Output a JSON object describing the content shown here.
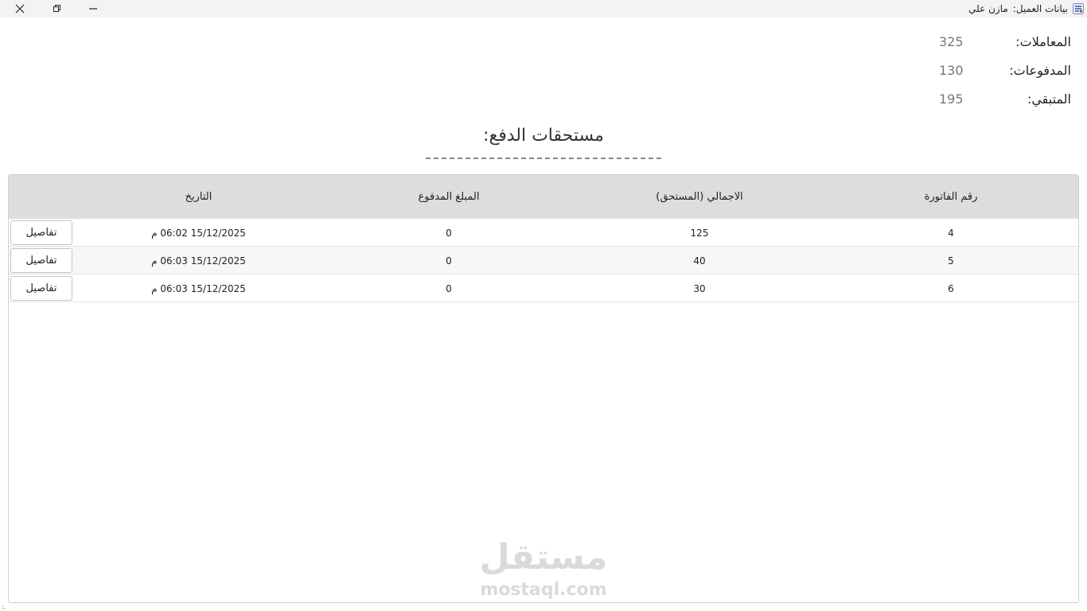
{
  "window": {
    "title_label": "بيانات العميل:",
    "client_name": "مازن علي",
    "controls": {
      "close": "close",
      "restore": "restore",
      "minimize": "minimize"
    },
    "app_icon": "app-icon"
  },
  "summary": {
    "transactions_label": "المعاملات:",
    "transactions_value": "325",
    "payments_label": "المدفوعات:",
    "payments_value": "130",
    "remaining_label": "المتبقي:",
    "remaining_value": "195"
  },
  "dues": {
    "title": "مستحقات الدفع:",
    "columns": {
      "invoice": "رقم الفاتورة",
      "total": "الاجمالي (المستحق)",
      "paid": "المبلغ المدفوع",
      "date": "التاريخ"
    },
    "rows": [
      {
        "invoice": "4",
        "total": "125",
        "paid": "0",
        "date": "15/12/2025 06:02 م",
        "action": "تفاصيل"
      },
      {
        "invoice": "5",
        "total": "40",
        "paid": "0",
        "date": "15/12/2025 06:03 م",
        "action": "تفاصيل"
      },
      {
        "invoice": "6",
        "total": "30",
        "paid": "0",
        "date": "15/12/2025 06:03 م",
        "action": "تفاصيل"
      }
    ]
  },
  "watermark": {
    "arabic": "مستقل",
    "latin": "mostaql.com"
  },
  "colors": {
    "header_bg": "#dddddd",
    "titlebar_bg": "#f3f3f3",
    "value_gray": "#777777",
    "rule": "#888888"
  }
}
